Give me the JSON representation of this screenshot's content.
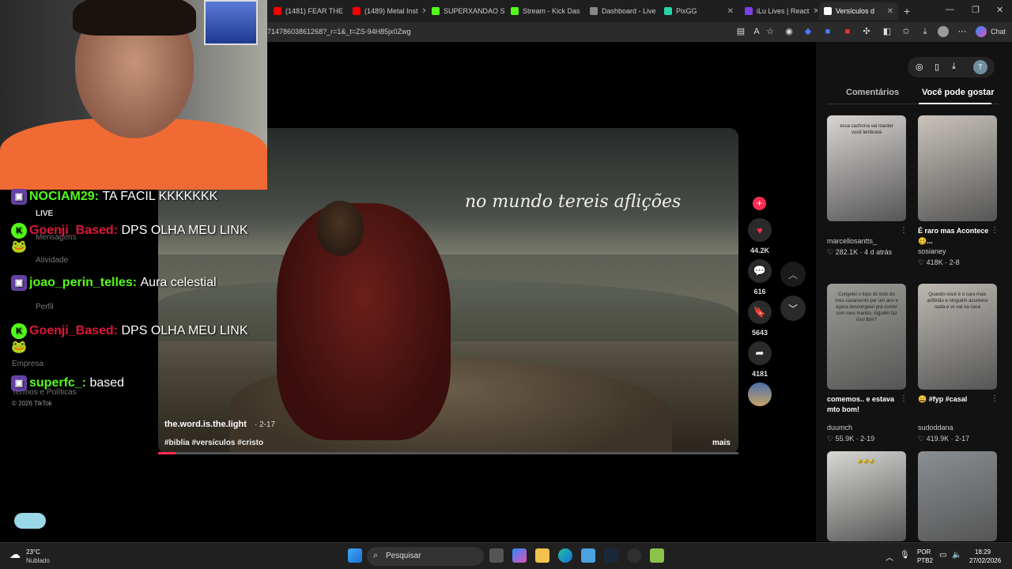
{
  "browser": {
    "tabs": [
      {
        "label": "(1481) FEAR THE",
        "color": "#ff0000"
      },
      {
        "label": "(1489) Metal Inst",
        "color": "#ff0000"
      },
      {
        "label": "SUPERXANDAO S",
        "color": "#53fc18"
      },
      {
        "label": "Stream - Kick Das",
        "color": "#53fc18"
      },
      {
        "label": "Dashboard - Live",
        "color": "#888888"
      },
      {
        "label": "PixGG",
        "color": "#26d3a7"
      },
      {
        "label": "iLu Lives | React",
        "color": "#7b3fe4"
      },
      {
        "label": "Versículos d",
        "color": "#ffffff"
      }
    ],
    "url": "7147860386126​8?_r=1&_t=ZS-94H85jx0Zwg",
    "chat_label": "Chat"
  },
  "video": {
    "caption": "no mundo tereis aflições",
    "author": "the.word.is.the.light",
    "date": "· 2-17",
    "tags": "#biblia #versículos #cristo",
    "more": "mais",
    "progress": 0.03,
    "likes": "44.2K",
    "comments": "616",
    "saves": "5643",
    "shares": "4181"
  },
  "right_panel": {
    "tab_comments": "Comentários",
    "tab_suggested": "Você pode gostar",
    "items": [
      {
        "title": "",
        "user": "marcellosantts_",
        "stats": "♡ 282.1K · 4 d atrás",
        "overlay": "essa cachorra vai manter você lembrará",
        "color": "#d8d4d2"
      },
      {
        "title": "É raro mas Acontece 🥴...",
        "user": "sosianey",
        "stats": "♡ 418K · 2-8",
        "overlay": "",
        "color": "#c9c3bb"
      },
      {
        "title": "comemos.. e estava mto bom!",
        "user": "duumch",
        "stats": "♡ 55.9K · 2-19",
        "overlay": "Congelei o topo do bolo do meu casamento por um ano e agora descongelei pra comer com meu marido. Alguém faz isso tbm?",
        "color": "#9c9c96"
      },
      {
        "title": "😄 #fyp #casal",
        "user": "sudoddana",
        "stats": "♡ 419.9K · 2-17",
        "overlay": "Quando você é o cara mais anfitrião e ninguém acontece nada e vc vai na casa",
        "color": "#bdb9b2"
      },
      {
        "title": "",
        "user": "",
        "stats": "",
        "overlay": "🤣🤣🤣",
        "color": "#d7d7d4"
      },
      {
        "title": "",
        "user": "",
        "stats": "",
        "overlay": "",
        "color": "#8a8f93"
      }
    ]
  },
  "chat": [
    {
      "user": "NOCIAM29:",
      "text": "TA FACIL KKKKKKK",
      "user_color": "#53fc18",
      "platform": "twitch"
    },
    {
      "user": "Goenji_Based:",
      "text": "DPS OLHA MEU LINK 🐸",
      "user_color": "#e0153a",
      "platform": "kick"
    },
    {
      "user": "joao_perin_telles:",
      "text": "Aura celestial",
      "user_color": "#53fc18",
      "platform": "twitch"
    },
    {
      "user": "Goenji_Based:",
      "text": "DPS OLHA MEU LINK 🐸",
      "user_color": "#e0153a",
      "platform": "kick"
    },
    {
      "user": "superfc_:",
      "text": "based",
      "user_color": "#53fc18",
      "platform": "twitch"
    }
  ],
  "sidebar_ghost": {
    "live": "LIVE",
    "messages": "Mensagens",
    "activity": "Atividade",
    "profile": "Perfil",
    "company": "Empresa",
    "terms": "Termos e Políticas",
    "copyright": "© 2026 TikTok"
  },
  "taskbar": {
    "weather_temp": "23°C",
    "weather_desc": "Nublado",
    "search": "Pesquisar",
    "lang1": "POR",
    "lang2": "PTB2",
    "time": "18:29",
    "date": "27/02/2026"
  }
}
